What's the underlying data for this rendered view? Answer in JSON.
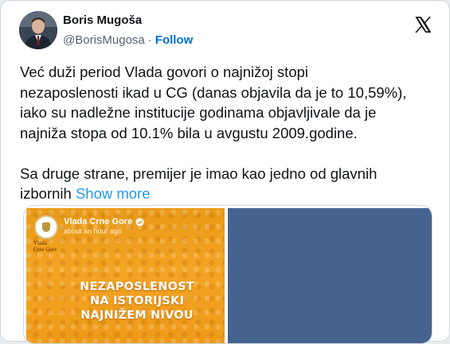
{
  "author": {
    "name": "Boris Mugoša",
    "handle": "@BorisMugosa",
    "separator": "·",
    "follow_label": "Follow",
    "avatar_icon": "person-portrait-icon"
  },
  "platform_logo": "x-logo-icon",
  "tweet": {
    "lines": [
      "Već duži period Vlada govori o najnižoj stopi",
      "nezaposlenosti ikad u CG (danas objavila da je to 10,59%),",
      "iako su nadležne institucije godinama objavljivale da je",
      "najniža stopa od 10.1% bila u avgustu 2009.godine."
    ],
    "lines2": [
      "Sa druge strane, premijer je imao kao jedno od glavnih"
    ],
    "last_line_text": "izbornih",
    "show_more_label": "Show more"
  },
  "media": {
    "page_name": "Vlada Crne Gore",
    "post_time": "about an hour ago",
    "seal_caption": [
      "Vlada",
      "Crne Gore"
    ],
    "headline_lines": [
      "NEZAPOSLENOST",
      "NA ISTORIJSKI",
      "NAJNIŽEM NIVOU"
    ],
    "colors": {
      "orange": "#f2a423",
      "blue_panel": "#46628f"
    }
  },
  "colors": {
    "link": "#1d9bf0",
    "follow": "#006fd6",
    "text": "#0f1419",
    "secondary": "#536471"
  }
}
